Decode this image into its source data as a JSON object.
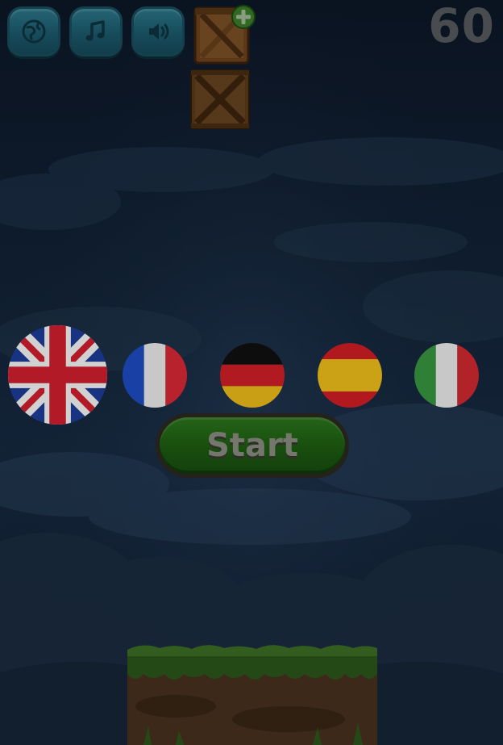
{
  "hud": {
    "score": "60",
    "buttons": [
      {
        "name": "language-button",
        "icon": "globe-icon"
      },
      {
        "name": "music-button",
        "icon": "music-note-icon"
      },
      {
        "name": "sound-button",
        "icon": "speaker-icon"
      }
    ],
    "add_crate_icon": "plus-icon"
  },
  "languages": [
    {
      "code": "en",
      "flag": "uk-flag-icon",
      "selected": true
    },
    {
      "code": "fr",
      "flag": "france-flag-icon",
      "selected": false
    },
    {
      "code": "de",
      "flag": "germany-flag-icon",
      "selected": false
    },
    {
      "code": "es",
      "flag": "spain-flag-icon",
      "selected": false
    },
    {
      "code": "it",
      "flag": "italy-flag-icon",
      "selected": false
    }
  ],
  "start_button": {
    "label": "Start"
  },
  "colors": {
    "hud_button": "#1d5d70",
    "start_green": "#1f6113",
    "score_gray": "#5a5d60",
    "crate_brown": "#7a4e24"
  }
}
